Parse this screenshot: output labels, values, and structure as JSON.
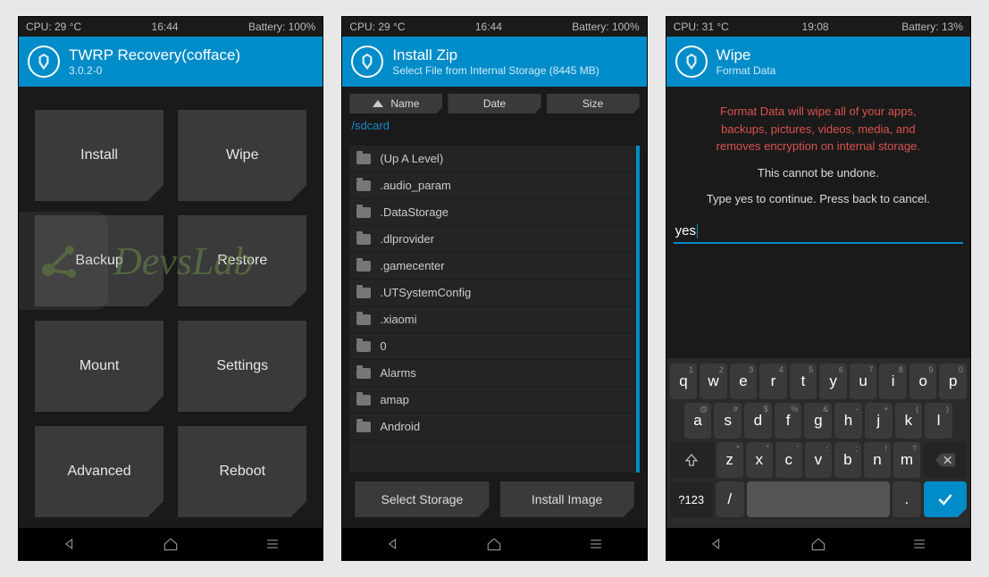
{
  "screen1": {
    "status": {
      "cpu": "CPU: 29 °C",
      "time": "16:44",
      "battery": "Battery: 100%"
    },
    "header": {
      "title": "TWRP Recovery(cofface)",
      "subtitle": "3.0.2-0"
    },
    "buttons": [
      "Install",
      "Wipe",
      "Backup",
      "Restore",
      "Mount",
      "Settings",
      "Advanced",
      "Reboot"
    ]
  },
  "screen2": {
    "status": {
      "cpu": "CPU: 29 °C",
      "time": "16:44",
      "battery": "Battery: 100%"
    },
    "header": {
      "title": "Install Zip",
      "subtitle": "Select File from Internal Storage (8445 MB)"
    },
    "sort": {
      "name": "Name",
      "date": "Date",
      "size": "Size"
    },
    "path": "/sdcard",
    "files": [
      "(Up A Level)",
      ".audio_param",
      ".DataStorage",
      ".dlprovider",
      ".gamecenter",
      ".UTSystemConfig",
      ".xiaomi",
      "0",
      "Alarms",
      "amap",
      "Android"
    ],
    "bottom": {
      "select_storage": "Select Storage",
      "install_image": "Install Image"
    }
  },
  "screen3": {
    "status": {
      "cpu": "CPU: 31 °C",
      "time": "19:08",
      "battery": "Battery: 13%"
    },
    "header": {
      "title": "Wipe",
      "subtitle": "Format Data"
    },
    "warn_l1": "Format Data will wipe all of your apps,",
    "warn_l2": "backups, pictures, videos, media, and",
    "warn_l3": "removes encryption on internal storage.",
    "undone": "This cannot be undone.",
    "prompt": "Type yes to continue.  Press back to cancel.",
    "input_value": "yes",
    "kb": {
      "row1": [
        "q",
        "w",
        "e",
        "r",
        "t",
        "y",
        "u",
        "i",
        "o",
        "p"
      ],
      "row1_sup": [
        "1",
        "2",
        "3",
        "4",
        "5",
        "6",
        "7",
        "8",
        "9",
        "0"
      ],
      "row2": [
        "a",
        "s",
        "d",
        "f",
        "g",
        "h",
        "j",
        "k",
        "l"
      ],
      "row2_sup": [
        "@",
        "#",
        "$",
        "%",
        "&",
        "-",
        "+",
        "(",
        ")"
      ],
      "row3": [
        "z",
        "x",
        "c",
        "v",
        "b",
        "n",
        "m"
      ],
      "row3_sup": [
        "*",
        "\"",
        "'",
        ":",
        ";",
        "!",
        "?"
      ],
      "row4": {
        "numkey": "?123",
        "slash": "/",
        "period": "."
      }
    }
  },
  "watermark": "DevsLab"
}
